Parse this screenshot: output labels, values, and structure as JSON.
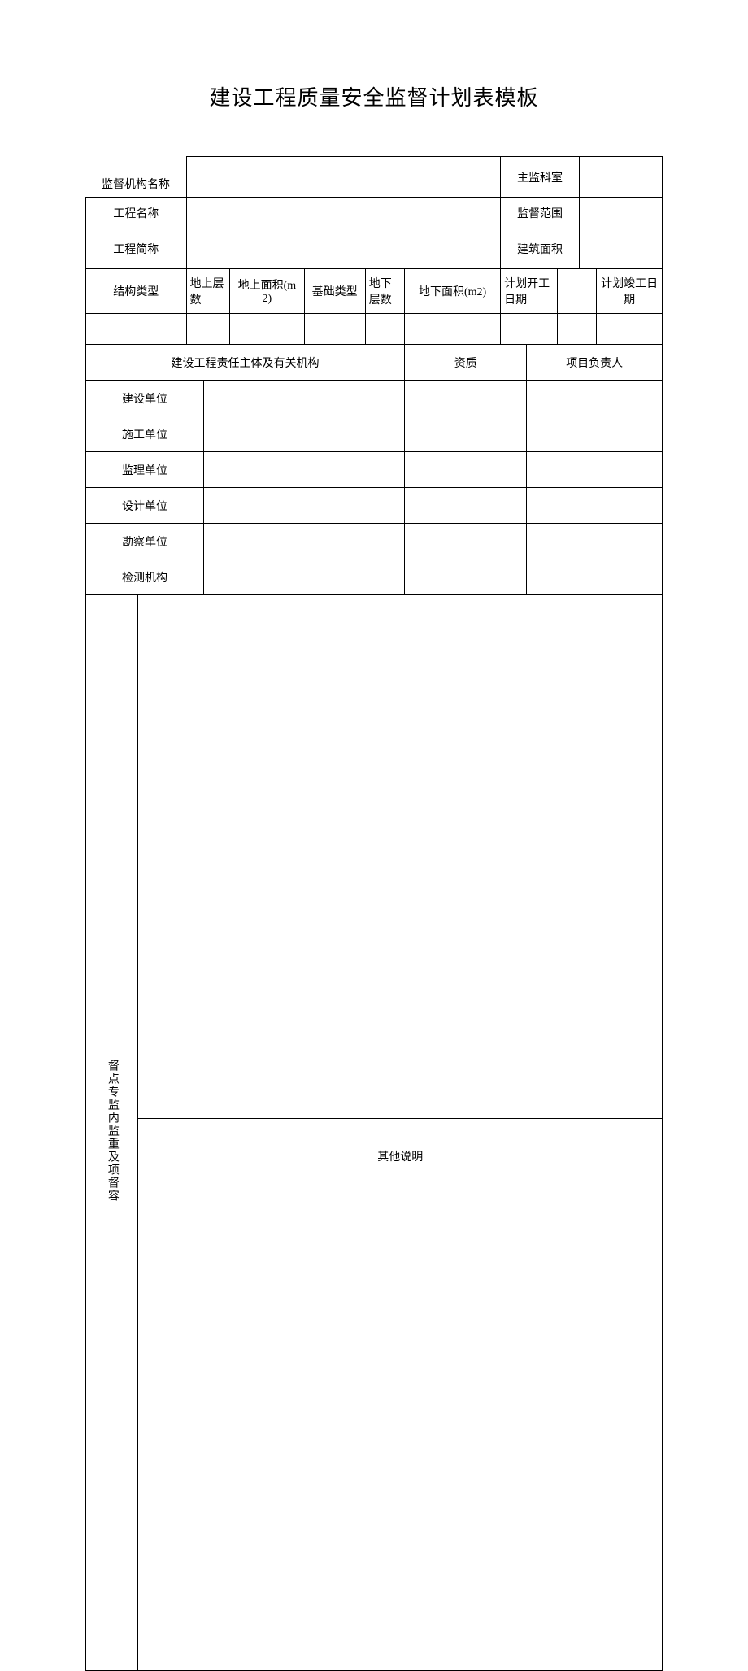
{
  "title": "建设工程质量安全监督计划表模板",
  "labels": {
    "org_name": "监督机构名称",
    "main_office": "主监科室",
    "project_name": "工程名称",
    "scope": "监督范围",
    "project_short": "工程简称",
    "building_area": "建筑面积",
    "structure_type": "结构类型",
    "floors_above": "地上层数",
    "area_above": "地上面积(m2)",
    "foundation_type": "基础类型",
    "floors_below": "地下层数",
    "area_below": "地下面积(m2)",
    "plan_start": "计划开工日期",
    "plan_end": "计划竣工日期",
    "responsible_bodies": "建设工程责任主体及有关机构",
    "qualification": "资质",
    "project_leader": "项目负责人",
    "build_unit": "建设单位",
    "construct_unit": "施工单位",
    "supervise_unit": "监理单位",
    "design_unit": "设计单位",
    "survey_unit": "勘察单位",
    "test_org": "检测机构",
    "special_content": "督点专监内监重及项督容",
    "other_notes": "其他说明"
  },
  "values": {
    "org_name": "",
    "main_office": "",
    "project_name": "",
    "scope": "",
    "project_short": "",
    "building_area": "",
    "structure_type": "",
    "floors_above": "",
    "area_above": "",
    "foundation_type": "",
    "floors_below": "",
    "area_below": "",
    "plan_start": "",
    "plan_end": "",
    "build_unit_name": "",
    "build_unit_qual": "",
    "build_unit_leader": "",
    "construct_unit_name": "",
    "construct_unit_qual": "",
    "construct_unit_leader": "",
    "supervise_unit_name": "",
    "supervise_unit_qual": "",
    "supervise_unit_leader": "",
    "design_unit_name": "",
    "design_unit_qual": "",
    "design_unit_leader": "",
    "survey_unit_name": "",
    "survey_unit_qual": "",
    "survey_unit_leader": "",
    "test_org_name": "",
    "test_org_qual": "",
    "test_org_leader": "",
    "special_content": "",
    "other_notes": ""
  }
}
